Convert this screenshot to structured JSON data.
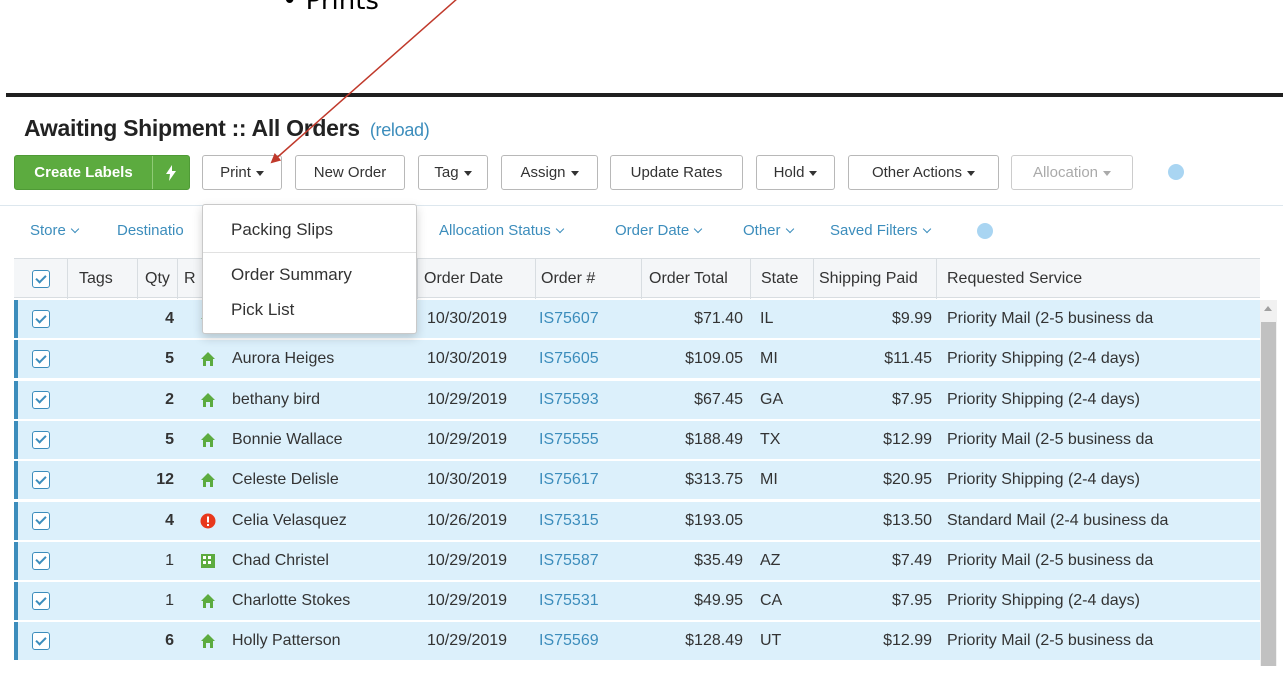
{
  "annotation": {
    "text": "• Prints"
  },
  "page": {
    "title": "Awaiting Shipment :: All Orders",
    "reload_label": "(reload)"
  },
  "toolbar": {
    "create_labels": "Create Labels",
    "bolt_icon": "lightning-bolt",
    "print": "Print",
    "new_order": "New Order",
    "tag": "Tag",
    "assign": "Assign",
    "update_rates": "Update Rates",
    "hold": "Hold",
    "other_actions": "Other Actions",
    "allocation": "Allocation",
    "accent": "#5cab3f"
  },
  "filters": {
    "store": "Store",
    "destination": "Destinatio",
    "allocation_status": "Allocation Status",
    "order_date": "Order Date",
    "other": "Other",
    "saved_filters": "Saved Filters"
  },
  "print_menu": {
    "items": [
      "Packing Slips",
      "Order Summary",
      "Pick List"
    ]
  },
  "columns": {
    "tags": "Tags",
    "qty": "Qty",
    "recipient": "R",
    "order_date": "Order Date",
    "order_num": "Order #",
    "order_total": "Order Total",
    "state": "State",
    "shipping_paid": "Shipping Paid",
    "requested_service": "Requested Service"
  },
  "rows": [
    {
      "qty": "4",
      "qty_bold": true,
      "icon": "house-icon",
      "name": "",
      "date": "10/30/2019",
      "order": "IS75607",
      "total": "$71.40",
      "state": "IL",
      "paid": "$9.99",
      "service": "Priority Mail (2-5 business da"
    },
    {
      "qty": "5",
      "qty_bold": true,
      "icon": "house-icon",
      "name": "Aurora Heiges",
      "date": "10/30/2019",
      "order": "IS75605",
      "total": "$109.05",
      "state": "MI",
      "paid": "$11.45",
      "service": "Priority Shipping (2-4 days)"
    },
    {
      "qty": "2",
      "qty_bold": true,
      "icon": "house-icon",
      "name": "bethany bird",
      "date": "10/29/2019",
      "order": "IS75593",
      "total": "$67.45",
      "state": "GA",
      "paid": "$7.95",
      "service": "Priority Shipping (2-4 days)"
    },
    {
      "qty": "5",
      "qty_bold": true,
      "icon": "house-icon",
      "name": "Bonnie Wallace",
      "date": "10/29/2019",
      "order": "IS75555",
      "total": "$188.49",
      "state": "TX",
      "paid": "$12.99",
      "service": "Priority Mail (2-5 business da"
    },
    {
      "qty": "12",
      "qty_bold": true,
      "icon": "house-icon",
      "name": "Celeste Delisle",
      "date": "10/30/2019",
      "order": "IS75617",
      "total": "$313.75",
      "state": "MI",
      "paid": "$20.95",
      "service": "Priority Shipping (2-4 days)"
    },
    {
      "qty": "4",
      "qty_bold": true,
      "icon": "alert-icon",
      "name": "Celia Velasquez",
      "date": "10/26/2019",
      "order": "IS75315",
      "total": "$193.05",
      "state": "",
      "paid": "$13.50",
      "service": "Standard Mail (2-4 business da"
    },
    {
      "qty": "1",
      "qty_bold": false,
      "icon": "building-icon",
      "name": "Chad Christel",
      "date": "10/29/2019",
      "order": "IS75587",
      "total": "$35.49",
      "state": "AZ",
      "paid": "$7.49",
      "service": "Priority Mail (2-5 business da"
    },
    {
      "qty": "1",
      "qty_bold": false,
      "icon": "house-icon",
      "name": "Charlotte Stokes",
      "date": "10/29/2019",
      "order": "IS75531",
      "total": "$49.95",
      "state": "CA",
      "paid": "$7.95",
      "service": "Priority Shipping (2-4 days)"
    },
    {
      "qty": "6",
      "qty_bold": true,
      "icon": "house-icon",
      "name": "Holly Patterson",
      "date": "10/29/2019",
      "order": "IS75569",
      "total": "$128.49",
      "state": "UT",
      "paid": "$12.99",
      "service": "Priority Mail (2-5 business da"
    }
  ],
  "colors": {
    "row_selected": "#dcf0fb",
    "link": "#3c8dbc",
    "house": "#5cab3f",
    "alert": "#e8381c"
  }
}
